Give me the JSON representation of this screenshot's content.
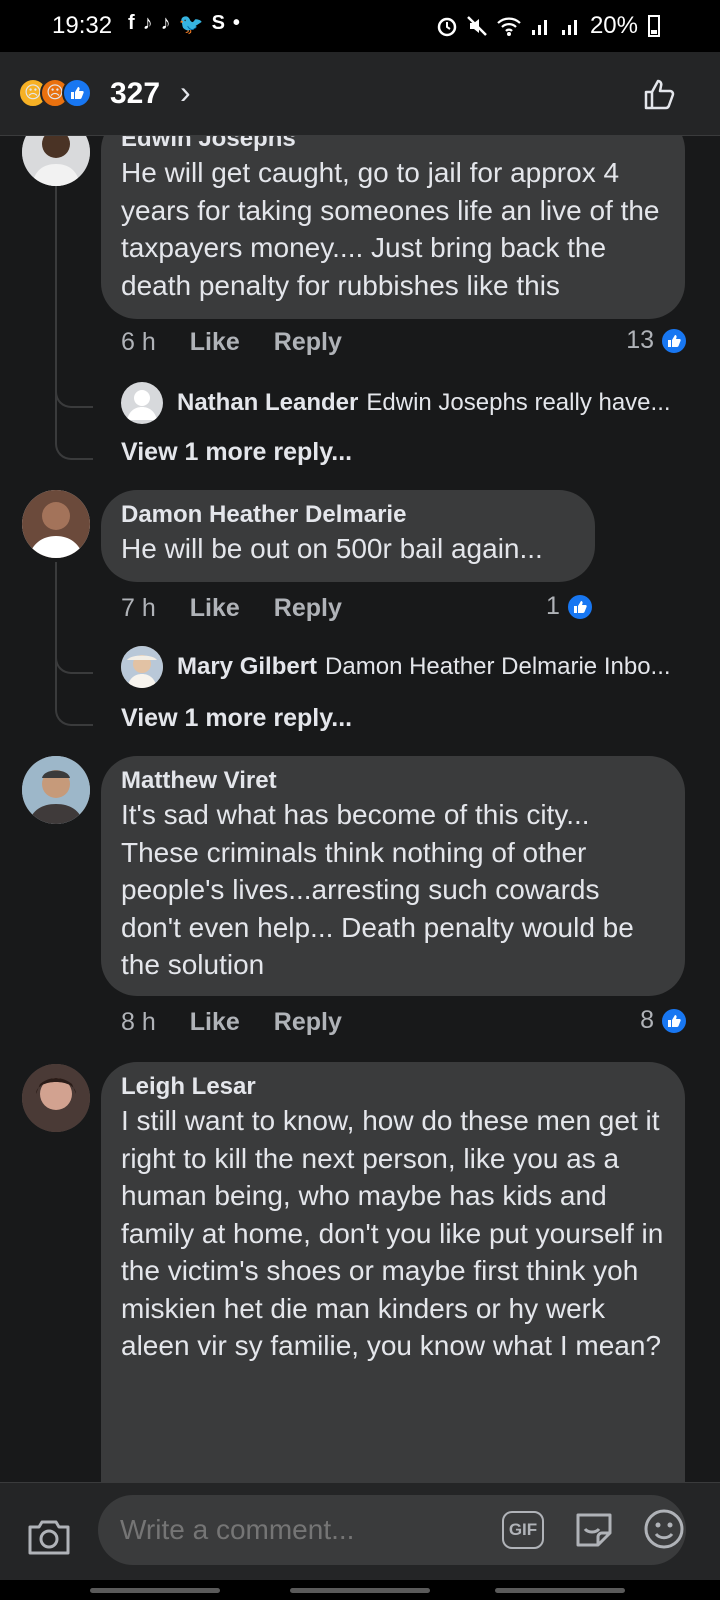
{
  "status_bar": {
    "time": "19:32",
    "apps": [
      "f",
      "♪",
      "♪",
      "🐦",
      "S",
      "•"
    ],
    "battery": "20%"
  },
  "header": {
    "reaction_count": "327",
    "reactions": [
      "sad",
      "angry",
      "like"
    ]
  },
  "comments": [
    {
      "id": "c1",
      "author": "Edwin Josephs",
      "text": "He will get caught, go to jail for approx 4 years for taking someones life an live of the taxpayers money.... Just bring back the death penalty for rubbishes like this",
      "time": "6 h",
      "like_label": "Like",
      "reply_label": "Reply",
      "likes": "13",
      "reply_preview": {
        "author": "Nathan Leander",
        "text": "Edwin Josephs really have..."
      },
      "view_more": "View 1 more reply..."
    },
    {
      "id": "c2",
      "author": "Damon Heather Delmarie",
      "text": "He will be out on 500r bail again...",
      "time": "7 h",
      "like_label": "Like",
      "reply_label": "Reply",
      "likes": "1",
      "reply_preview": {
        "author": "Mary Gilbert",
        "text": "Damon Heather Delmarie Inbo..."
      },
      "view_more": "View 1 more reply..."
    },
    {
      "id": "c3",
      "author": "Matthew Viret",
      "text": "It's sad what has become of this city... These criminals think nothing of other people's lives...arresting such cowards don't even help... Death penalty would be the solution",
      "time": "8 h",
      "like_label": "Like",
      "reply_label": "Reply",
      "likes": "8"
    },
    {
      "id": "c4",
      "author": "Leigh Lesar",
      "text": "I still want to know, how do these men get it right to kill the next person, like you as a human being, who maybe has kids and family at home, don't you like put yourself in the victim's shoes or maybe first think yoh miskien het die man kinders or hy werk aleen vir sy familie, you know what I mean?"
    }
  ],
  "composer": {
    "placeholder": "Write a comment...",
    "gif_label": "GIF"
  },
  "colors": {
    "background": "#18191a",
    "bubble": "#3a3b3c",
    "accent": "#1877f2",
    "muted": "#b0b3b8"
  }
}
